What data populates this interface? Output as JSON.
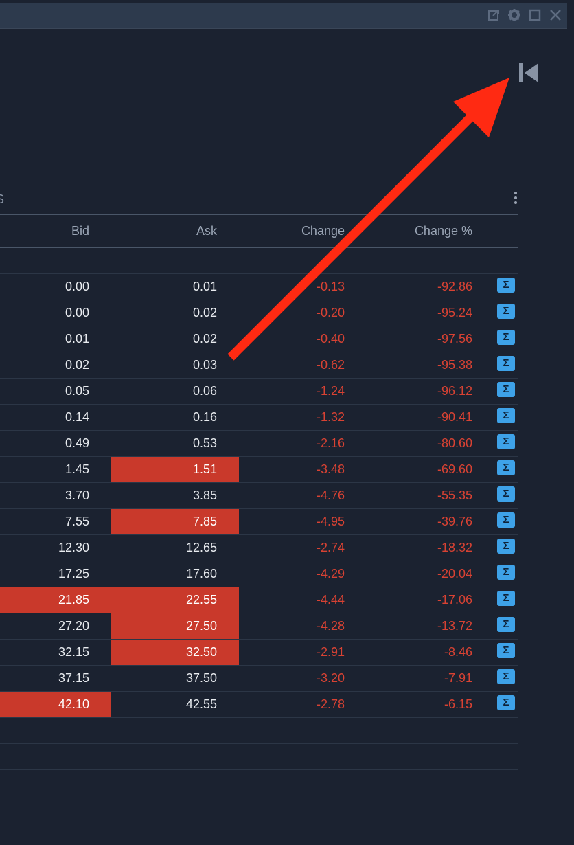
{
  "panel": {
    "tab_label": "S"
  },
  "headers": {
    "bid": "Bid",
    "ask": "Ask",
    "change": "Change",
    "change_pct": "Change %"
  },
  "icons": {
    "popout": "popout-icon",
    "settings": "gear-icon",
    "maximize": "maximize-icon",
    "close": "close-icon",
    "first_page": "skip-to-first-icon",
    "menu": "kebab-menu-icon",
    "sigma": "Σ"
  },
  "colors": {
    "negative": "#d84233",
    "highlight": "#c9392b",
    "sigma_badge": "#3ea2e8",
    "annotation_arrow": "#ff2a12"
  },
  "rows": [
    {
      "bid": "0.00",
      "ask": "0.01",
      "change": "-0.13",
      "change_pct": "-92.86",
      "bid_hl": false,
      "ask_hl": false
    },
    {
      "bid": "0.00",
      "ask": "0.02",
      "change": "-0.20",
      "change_pct": "-95.24",
      "bid_hl": false,
      "ask_hl": false
    },
    {
      "bid": "0.01",
      "ask": "0.02",
      "change": "-0.40",
      "change_pct": "-97.56",
      "bid_hl": false,
      "ask_hl": false
    },
    {
      "bid": "0.02",
      "ask": "0.03",
      "change": "-0.62",
      "change_pct": "-95.38",
      "bid_hl": false,
      "ask_hl": false
    },
    {
      "bid": "0.05",
      "ask": "0.06",
      "change": "-1.24",
      "change_pct": "-96.12",
      "bid_hl": false,
      "ask_hl": false
    },
    {
      "bid": "0.14",
      "ask": "0.16",
      "change": "-1.32",
      "change_pct": "-90.41",
      "bid_hl": false,
      "ask_hl": false
    },
    {
      "bid": "0.49",
      "ask": "0.53",
      "change": "-2.16",
      "change_pct": "-80.60",
      "bid_hl": false,
      "ask_hl": false
    },
    {
      "bid": "1.45",
      "ask": "1.51",
      "change": "-3.48",
      "change_pct": "-69.60",
      "bid_hl": false,
      "ask_hl": true
    },
    {
      "bid": "3.70",
      "ask": "3.85",
      "change": "-4.76",
      "change_pct": "-55.35",
      "bid_hl": false,
      "ask_hl": false
    },
    {
      "bid": "7.55",
      "ask": "7.85",
      "change": "-4.95",
      "change_pct": "-39.76",
      "bid_hl": false,
      "ask_hl": true
    },
    {
      "bid": "12.30",
      "ask": "12.65",
      "change": "-2.74",
      "change_pct": "-18.32",
      "bid_hl": false,
      "ask_hl": false
    },
    {
      "bid": "17.25",
      "ask": "17.60",
      "change": "-4.29",
      "change_pct": "-20.04",
      "bid_hl": false,
      "ask_hl": false
    },
    {
      "bid": "21.85",
      "ask": "22.55",
      "change": "-4.44",
      "change_pct": "-17.06",
      "bid_hl": true,
      "ask_hl": true
    },
    {
      "bid": "27.20",
      "ask": "27.50",
      "change": "-4.28",
      "change_pct": "-13.72",
      "bid_hl": false,
      "ask_hl": true
    },
    {
      "bid": "32.15",
      "ask": "32.50",
      "change": "-2.91",
      "change_pct": "-8.46",
      "bid_hl": false,
      "ask_hl": true
    },
    {
      "bid": "37.15",
      "ask": "37.50",
      "change": "-3.20",
      "change_pct": "-7.91",
      "bid_hl": false,
      "ask_hl": false
    },
    {
      "bid": "42.10",
      "ask": "42.55",
      "change": "-2.78",
      "change_pct": "-6.15",
      "bid_hl": true,
      "ask_hl": false
    }
  ]
}
